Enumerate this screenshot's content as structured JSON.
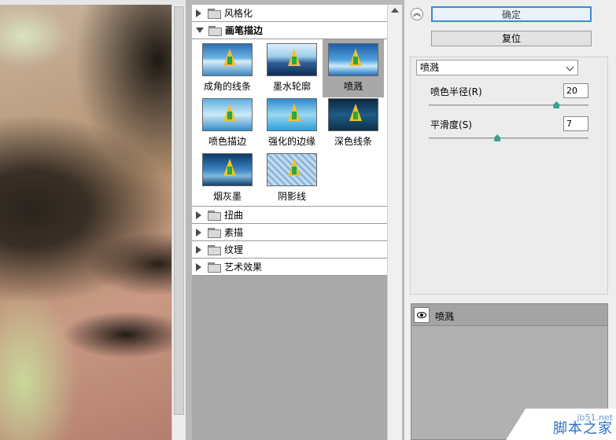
{
  "gallery": {
    "categories_top": [
      {
        "label": "风格化",
        "expanded": false
      }
    ],
    "open_category": {
      "label": "画笔描边",
      "expanded": true
    },
    "thumbnails": [
      {
        "label": "成角的线条",
        "selected": false
      },
      {
        "label": "墨水轮廓",
        "selected": false
      },
      {
        "label": "喷溅",
        "selected": true
      },
      {
        "label": "喷色描边",
        "selected": false
      },
      {
        "label": "强化的边缘",
        "selected": false
      },
      {
        "label": "深色线条",
        "selected": false
      },
      {
        "label": "烟灰墨",
        "selected": false
      },
      {
        "label": "阴影线",
        "selected": false
      }
    ],
    "categories_bottom": [
      {
        "label": "扭曲"
      },
      {
        "label": "素描"
      },
      {
        "label": "纹理"
      },
      {
        "label": "艺术效果"
      }
    ]
  },
  "settings": {
    "ok_label": "确定",
    "reset_label": "复位",
    "filter_select": "喷溅",
    "params": [
      {
        "label": "喷色半径(R)",
        "value": "20",
        "level": 0.8
      },
      {
        "label": "平滑度(S)",
        "value": "7",
        "level": 0.43
      }
    ]
  },
  "layers": {
    "items": [
      {
        "name": "喷溅",
        "visible": true
      }
    ]
  },
  "watermark": {
    "url": "jb51.net",
    "name": "脚本之家"
  }
}
